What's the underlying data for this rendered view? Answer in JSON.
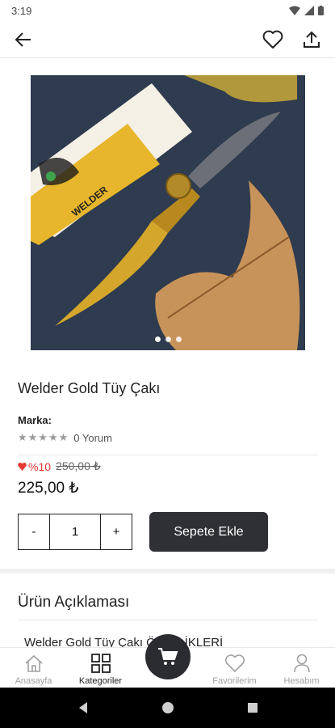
{
  "status_bar": {
    "time": "3:19"
  },
  "app_bar": {
    "back_icon": "arrow-left-icon",
    "favorite_icon": "heart-outline-icon",
    "share_icon": "share-upload-icon"
  },
  "product": {
    "image_alt": "Welder Gold Tüy Çakı",
    "image_box_text": "WELDER",
    "gallery_total": 3,
    "gallery_active_index": 0,
    "title": "Welder Gold Tüy Çakı",
    "brand_label": "Marka:",
    "stars": "★★★★★",
    "rating_value": 0,
    "reviews_text": "0 Yorum",
    "discount_text": "%10",
    "old_price": "250,00 ₺",
    "price": "225,00 ₺"
  },
  "cart_controls": {
    "minus_label": "-",
    "quantity": "1",
    "plus_label": "+",
    "add_to_cart_label": "Sepete Ekle"
  },
  "description": {
    "heading": "Ürün Açıklaması",
    "first_line": "Welder Gold Tüy Çakı ÖZELLİKLERİ"
  },
  "bottom_nav": {
    "items": [
      {
        "label": "Anasayfa",
        "icon": "home-icon"
      },
      {
        "label": "Kategoriler",
        "icon": "grid-icon"
      },
      {
        "label": "",
        "icon": "cart-icon"
      },
      {
        "label": "Favorilerim",
        "icon": "heart-icon"
      },
      {
        "label": "Hesabım",
        "icon": "user-icon"
      }
    ],
    "active_index": 1
  },
  "colors": {
    "accent_dark": "#2e3034",
    "discount_red": "#e53935",
    "muted_gray": "#a0a0a0"
  }
}
